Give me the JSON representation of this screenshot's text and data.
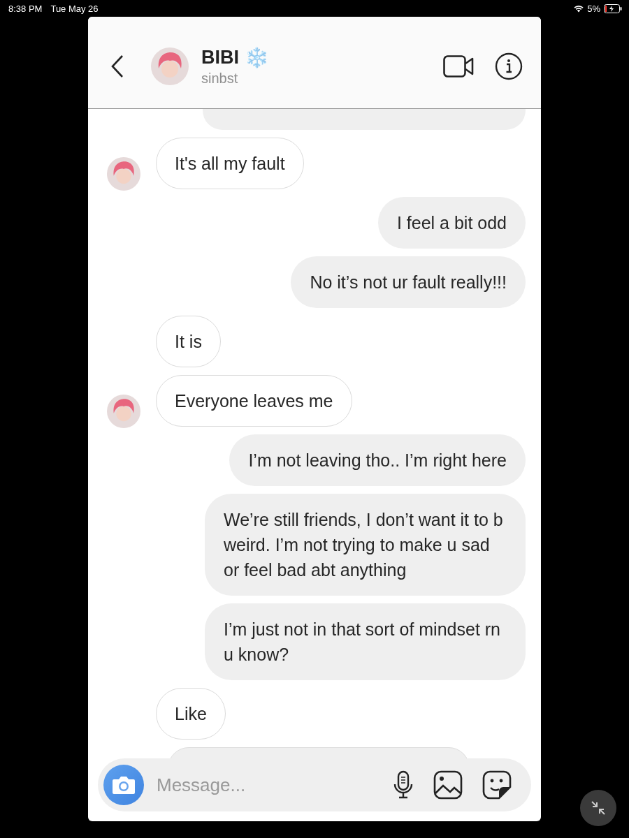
{
  "status_bar": {
    "time": "8:38 PM",
    "date": "Tue May 26",
    "battery": "5%"
  },
  "header": {
    "name": "BIBI",
    "name_emoji": "❄️",
    "username": "sinbst"
  },
  "messages": [
    {
      "kind": "received",
      "avatar": true,
      "text": "It's all my fault"
    },
    {
      "kind": "sent",
      "text": "I feel a bit odd"
    },
    {
      "kind": "sent",
      "text": "No it’s not ur fault really!!!"
    },
    {
      "kind": "received",
      "avatar": false,
      "text": "It is"
    },
    {
      "kind": "received",
      "avatar": true,
      "text": "Everyone leaves me"
    },
    {
      "kind": "sent",
      "text": "I’m not leaving tho.. I’m right here"
    },
    {
      "kind": "sent",
      "text": "We’re still friends, I don’t want it to b weird. I’m not trying to make u sad or feel bad abt anything"
    },
    {
      "kind": "sent",
      "text": "I’m just not in that sort of mindset rn u know?"
    },
    {
      "kind": "received",
      "avatar": false,
      "text": "Like"
    }
  ],
  "composer": {
    "placeholder": "Message..."
  }
}
